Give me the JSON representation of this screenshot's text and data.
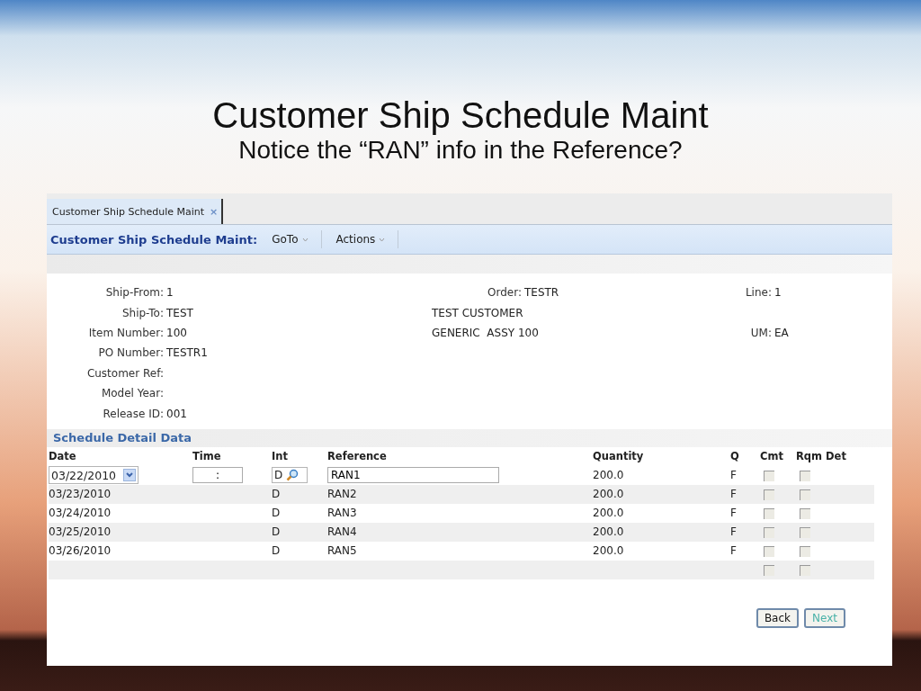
{
  "slide": {
    "title": "Customer Ship Schedule Maint",
    "subtitle": "Notice the “RAN” info in the Reference?"
  },
  "tabs": [
    {
      "label": "Customer Ship Schedule Maint",
      "close": "×",
      "selected": true
    }
  ],
  "toolbar": {
    "title": "Customer Ship Schedule Maint:",
    "menus": [
      {
        "label": "GoTo"
      },
      {
        "label": "Actions"
      }
    ]
  },
  "form": {
    "rows": [
      {
        "left": {
          "label": "Ship-From:",
          "value": "1"
        },
        "center": {
          "label": "Order:",
          "value": "TESTR"
        },
        "right": {
          "label": "Line:",
          "value": "1"
        }
      },
      {
        "left": {
          "label": "Ship-To:",
          "value": "TEST"
        },
        "center": {
          "value": "TEST CUSTOMER"
        }
      },
      {
        "left": {
          "label": "Item Number:",
          "value": "100"
        },
        "center": {
          "value": "GENERIC  ASSY 100"
        },
        "right": {
          "label": "UM:",
          "value": "EA"
        }
      },
      {
        "left": {
          "label": "PO Number:",
          "value": "TESTR1"
        }
      },
      {
        "left": {
          "label": "Customer Ref:"
        }
      },
      {
        "left": {
          "label": "Model Year:"
        }
      },
      {
        "left": {
          "label": "Release ID:",
          "value": "001"
        }
      }
    ]
  },
  "schedule": {
    "title": "Schedule Detail Data",
    "columns": [
      "Date",
      "Time",
      "Int",
      "Reference",
      "Quantity",
      "Q",
      "Cmt",
      "Rqm Det"
    ],
    "rows": [
      {
        "kind": "edit",
        "date": "03/22/2010",
        "time": ":",
        "int": "D",
        "reference": "RAN1",
        "quantity": "200.0",
        "q": "F",
        "cmt": false,
        "rqm_det": false
      },
      {
        "kind": "text",
        "date": "03/23/2010",
        "int": "D",
        "reference": "RAN2",
        "quantity": "200.0",
        "q": "F",
        "cmt": false,
        "rqm_det": false
      },
      {
        "kind": "text",
        "date": "03/24/2010",
        "int": "D",
        "reference": "RAN3",
        "quantity": "200.0",
        "q": "F",
        "cmt": false,
        "rqm_det": false
      },
      {
        "kind": "text",
        "date": "03/25/2010",
        "int": "D",
        "reference": "RAN4",
        "quantity": "200.0",
        "q": "F",
        "cmt": false,
        "rqm_det": false
      },
      {
        "kind": "text",
        "date": "03/26/2010",
        "int": "D",
        "reference": "RAN5",
        "quantity": "200.0",
        "q": "F",
        "cmt": false,
        "rqm_det": false
      },
      {
        "kind": "blank",
        "cmt": false,
        "rqm_det": false
      }
    ]
  },
  "buttons": [
    {
      "label": "Back",
      "disabled": false
    },
    {
      "label": "Next",
      "disabled": true
    }
  ]
}
